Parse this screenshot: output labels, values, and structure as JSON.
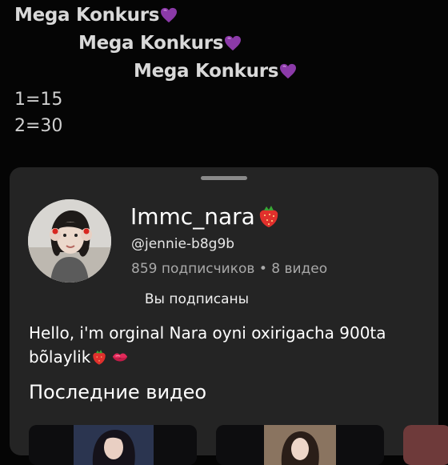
{
  "caption": {
    "lines": [
      "Mega Konkurs",
      "Mega Konkurs",
      "Mega Konkurs"
    ],
    "heart_icon": "purple-heart-icon",
    "heart_color": "#8b3aa8",
    "notes": [
      "1=15",
      "2=30"
    ]
  },
  "profile": {
    "name": "Immc_nara",
    "name_icon": "strawberry-icon",
    "handle": "@jennie-b8g9b",
    "stats": "859 подписчиков • 8 видео",
    "subscribe_label": "Вы подписаны",
    "bio_line1": "Hello, i'm orginal Nara oyni oxirigacha 900ta",
    "bio_line2": "bõlaylik",
    "bio_icons": [
      "strawberry-icon",
      "kiss-lips-icon"
    ]
  },
  "recent": {
    "title": "Последние видео"
  },
  "colors": {
    "sheet_bg": "#242424",
    "page_bg": "#050505",
    "accent_red": "#e0302c"
  }
}
